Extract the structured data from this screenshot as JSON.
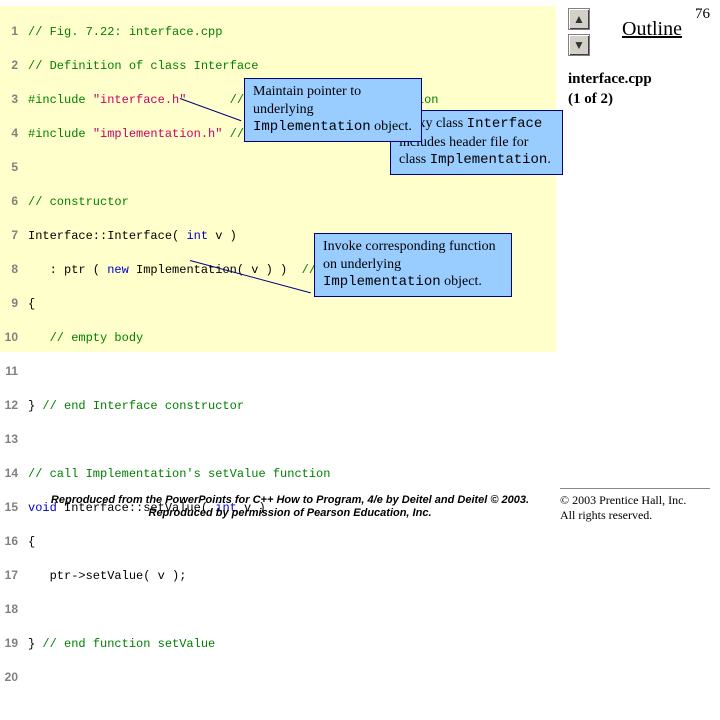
{
  "page_number": "76",
  "outline_label": "Outline",
  "file": {
    "name": "interface.cpp",
    "part": "(1 of 2)"
  },
  "code": {
    "l1": "// Fig. 7.22: interface.cpp",
    "l2": "// Definition of class Interface",
    "l3a": "#include",
    "l3b": "\"interface.h\"",
    "l3c": "// Interface class definition",
    "l4a": "#include",
    "l4b": "\"implementation.h\"",
    "l4c": "// Implementation class definition",
    "l6": "// constructor",
    "l7a": "Interface::Interface( ",
    "l7b": "int",
    "l7c": " v ) ",
    "l8a": "   : ptr ( ",
    "l8b": "new",
    "l8c": " Implementation( v ) )  ",
    "l8d": "// initialize ptr",
    "l9": "{ ",
    "l10": "   // empty body",
    "l12a": "} ",
    "l12b": "// end Interface constructor",
    "l14": "// call Implementation's setValue function",
    "l15a": "void",
    "l15b": " Interface::setValue( ",
    "l15c": "int",
    "l15d": " v ) ",
    "l16": "{ ",
    "l17": "   ptr->setValue( v );",
    "l19a": "} ",
    "l19b": "// end function setValue"
  },
  "callouts": {
    "c1_a": "Maintain pointer to underlying ",
    "c1_b": "Implementation",
    "c1_c": " object.",
    "c2_a": "Proxy class ",
    "c2_b": "Interface",
    "c2_c": " includes header file for class ",
    "c2_d": "Implementation",
    "c2_e": ".",
    "c3_a": "Invoke corresponding function on underlying ",
    "c3_b": "Implementation",
    "c3_c": " object."
  },
  "copyright_l1": "© 2003 Prentice Hall, Inc.",
  "copyright_l2": "All rights reserved.",
  "reproduced": "Reproduced from the PowerPoints for C++ How to Program, 4/e by Deitel and Deitel © 2003. Reproduced by permission of Pearson Education, Inc."
}
